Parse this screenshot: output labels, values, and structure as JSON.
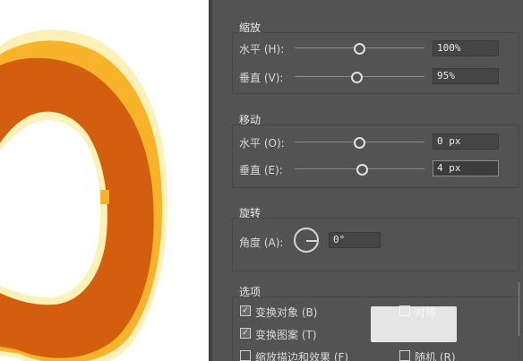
{
  "dialog": {
    "scale": {
      "title": "缩放",
      "horizontal_label": "水平 (H):",
      "horizontal_value": "100%",
      "horizontal_slider": 0.5,
      "vertical_label": "垂直 (V):",
      "vertical_value": "95%",
      "vertical_slider": 0.475
    },
    "move": {
      "title": "移动",
      "horizontal_label": "水平 (O):",
      "horizontal_value": "0 px",
      "horizontal_slider": 0.5,
      "vertical_label": "垂直 (E):",
      "vertical_value": "4 px",
      "vertical_slider": 0.52
    },
    "rotate": {
      "title": "旋转",
      "angle_label": "角度 (A):",
      "angle_value": "0°"
    },
    "options": {
      "title": "选项",
      "transform_objects": {
        "label": "变换对象 (B)",
        "checked": true
      },
      "transform_patterns": {
        "label": "变换图案 (T)",
        "checked": true
      },
      "scale_strokes": {
        "label": "缩放描边和效果 (F)",
        "checked": false
      },
      "reflect": {
        "label": "对称",
        "checked": false
      },
      "random": {
        "label": "随机 (R)",
        "checked": false
      }
    }
  },
  "colors": {
    "panel_bg": "#535353",
    "shape_orange": "#d35f0e",
    "shape_yellow": "#f8b32b",
    "shape_cream": "#fdf1b8"
  }
}
